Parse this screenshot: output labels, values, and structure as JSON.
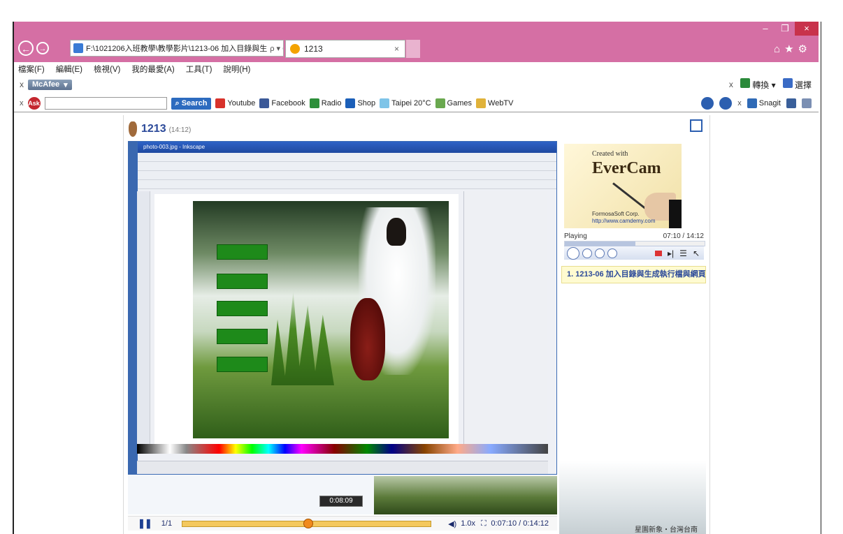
{
  "browser": {
    "address": "F:\\1021206入班教學\\教學影片\\1213-06 加入目錄與生",
    "address_tools": "ρ ▾ C",
    "tab_title": "1213",
    "tab_close": "×",
    "window_buttons": [
      "–",
      "❐",
      "×"
    ]
  },
  "menu": [
    "檔案(F)",
    "編輯(E)",
    "檢視(V)",
    "我的最愛(A)",
    "工具(T)",
    "說明(H)"
  ],
  "mcafee": {
    "label": "McAfee",
    "right_items": [
      "轉換",
      "選擇"
    ]
  },
  "ask_toolbar": {
    "search_button": "Search",
    "items": [
      "Youtube",
      "Facebook",
      "Radio",
      "Shop",
      "Taipei 20°C",
      "Games",
      "WebTV"
    ],
    "snagit": "Snagit",
    "colors": {
      "youtube": "#d8322b",
      "facebook": "#3b5998",
      "radio": "#2d8f3a",
      "shop": "#1b5fb8",
      "weather": "#7ec4e8",
      "games": "#6aa84f",
      "webtv": "#e0b23a"
    }
  },
  "player": {
    "title": "1213",
    "duration": "(14:12)",
    "logo_small": "Created with",
    "logo_big": "EverCam",
    "logo_corp": "FormosaSoft Corp.",
    "logo_url": "http://www.camdemy.com",
    "status": "Playing",
    "time": "07:10 / 14:12",
    "progress_fraction": 0.505,
    "chapter": "1. 1213-06 加入目錄與生成執行檔與網頁檔",
    "video_title": "photo-003.jpg - Inkscape",
    "video_clock": "0:08:09",
    "bottom": {
      "page": "1/1",
      "speed": "1.0x",
      "time": "0:07:10 / 0:14:12",
      "seek_fraction": 0.505
    },
    "decor_caption": "星園新象・台灣台南"
  }
}
